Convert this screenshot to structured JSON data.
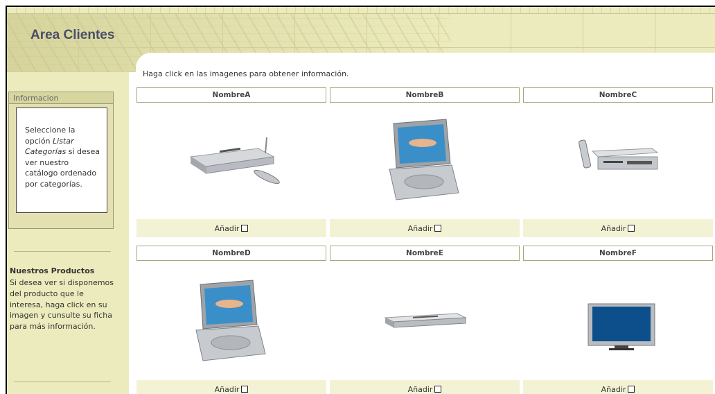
{
  "header": {
    "title": "Area Clientes"
  },
  "sidebar": {
    "info_title": "Informacion",
    "info_lines": [
      "Seleccione la",
      "opción ",
      "Listar",
      " ",
      "Categorías",
      " si desea",
      "ver nuestro",
      "catálogo ordenado",
      "por categorías."
    ],
    "products_title": "Nuestros Productos",
    "products_text": "Si desea ver si disponemos del producto que le interesa, haga click en su imagen y cunsulte su ficha para más información."
  },
  "main": {
    "intro": "Haga click en las imagenes para obtener información.",
    "add_label": "Añadir",
    "products": [
      {
        "name": "NombreA",
        "icon": "dvd-player-with-remote-icon"
      },
      {
        "name": "NombreB",
        "icon": "portable-dvd-player-icon"
      },
      {
        "name": "NombreC",
        "icon": "vcr-with-remote-icon"
      },
      {
        "name": "NombreD",
        "icon": "portable-dvd-player-icon"
      },
      {
        "name": "NombreE",
        "icon": "slim-dvd-player-icon"
      },
      {
        "name": "NombreF",
        "icon": "flat-screen-tv-icon"
      }
    ]
  },
  "colors": {
    "sidebar_bg": "#ecebbd",
    "add_bar_bg": "#f3f2d4",
    "brand_text": "#4a4e68"
  }
}
